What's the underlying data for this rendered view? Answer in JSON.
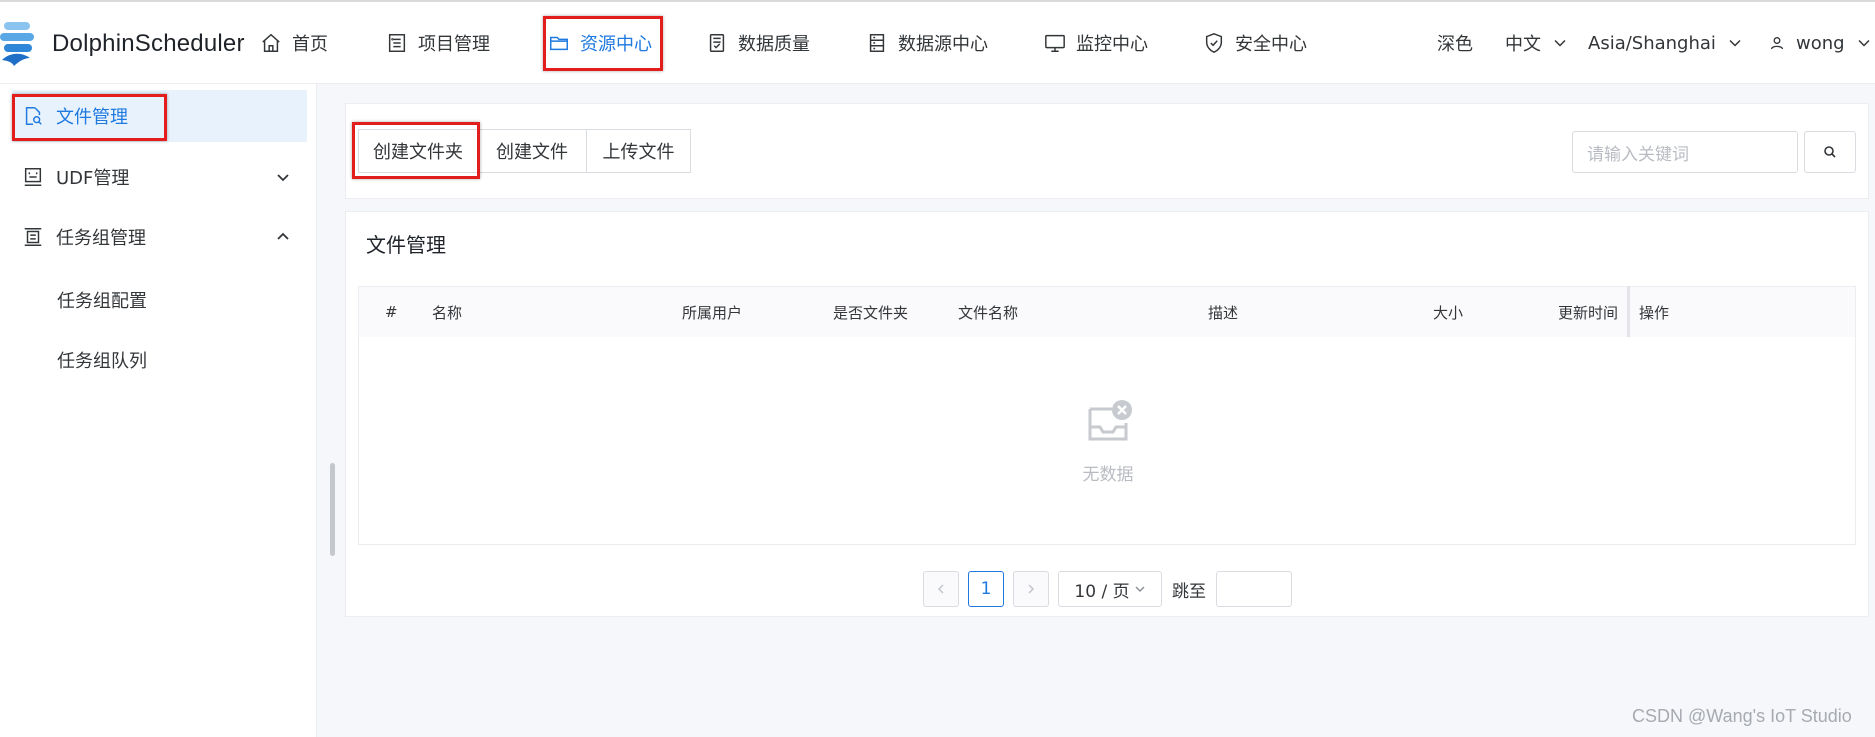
{
  "app": {
    "name": "DolphinScheduler"
  },
  "nav": {
    "items": [
      {
        "label": "首页",
        "icon": "home-icon"
      },
      {
        "label": "项目管理",
        "icon": "project-list-icon"
      },
      {
        "label": "资源中心",
        "icon": "folder-icon",
        "active": true
      },
      {
        "label": "数据质量",
        "icon": "data-quality-icon"
      },
      {
        "label": "数据源中心",
        "icon": "datasource-icon"
      },
      {
        "label": "监控中心",
        "icon": "monitor-icon"
      },
      {
        "label": "安全中心",
        "icon": "shield-icon"
      }
    ],
    "theme": "深色",
    "language": "中文",
    "timezone": "Asia/Shanghai",
    "user": "wong"
  },
  "sidebar": {
    "items": [
      {
        "label": "文件管理",
        "icon": "file-search-icon",
        "active": true
      },
      {
        "label": "UDF管理",
        "icon": "udf-icon",
        "expanded": false
      },
      {
        "label": "任务组管理",
        "icon": "task-group-icon",
        "expanded": true
      }
    ],
    "sub_items": [
      "任务组配置",
      "任务组队列"
    ]
  },
  "toolbar": {
    "create_folder": "创建文件夹",
    "create_file": "创建文件",
    "upload_file": "上传文件",
    "search_placeholder": "请输入关键词"
  },
  "table": {
    "title": "文件管理",
    "columns": [
      "#",
      "名称",
      "所属用户",
      "是否文件夹",
      "文件名称",
      "描述",
      "大小",
      "更新时间",
      "操作"
    ],
    "rows": [],
    "empty_text": "无数据"
  },
  "pagination": {
    "current_page": "1",
    "page_size": "10 / 页",
    "jump_label": "跳至"
  },
  "watermark": "CSDN @Wang's IoT Studio",
  "colors": {
    "accent": "#1f7ae0",
    "highlight_box": "#e31c1c",
    "active_bg": "#e7f2fd"
  }
}
